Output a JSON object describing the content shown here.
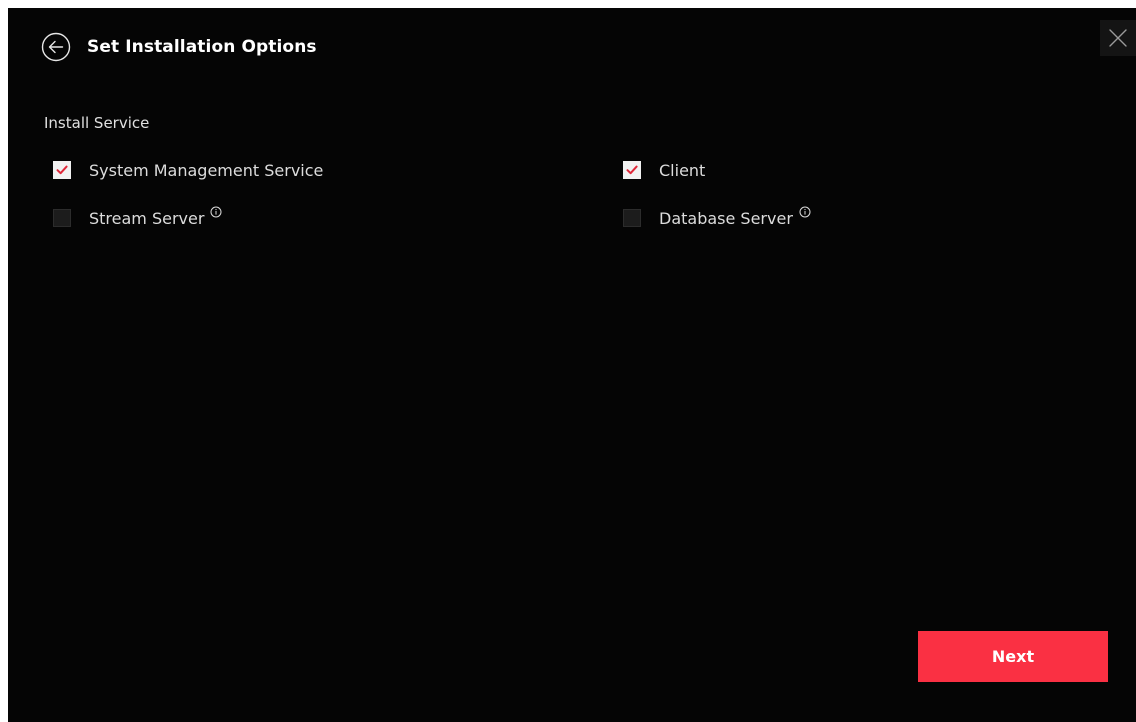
{
  "dialog": {
    "title": "Set Installation Options",
    "close_icon": "close-icon",
    "back_icon": "arrow-left-circle-icon"
  },
  "install_service": {
    "label": "Install Service",
    "options": [
      {
        "label": "System Management Service",
        "checked": true
      },
      {
        "label": "Client",
        "checked": true
      },
      {
        "label": "Stream Server",
        "checked": false,
        "info": true
      },
      {
        "label": "Database Server",
        "checked": false,
        "info": true
      }
    ]
  },
  "footer": {
    "next_label": "Next"
  },
  "colors": {
    "accent": "#fa3043",
    "background": "#050505",
    "checkmark": "#e0283a"
  }
}
